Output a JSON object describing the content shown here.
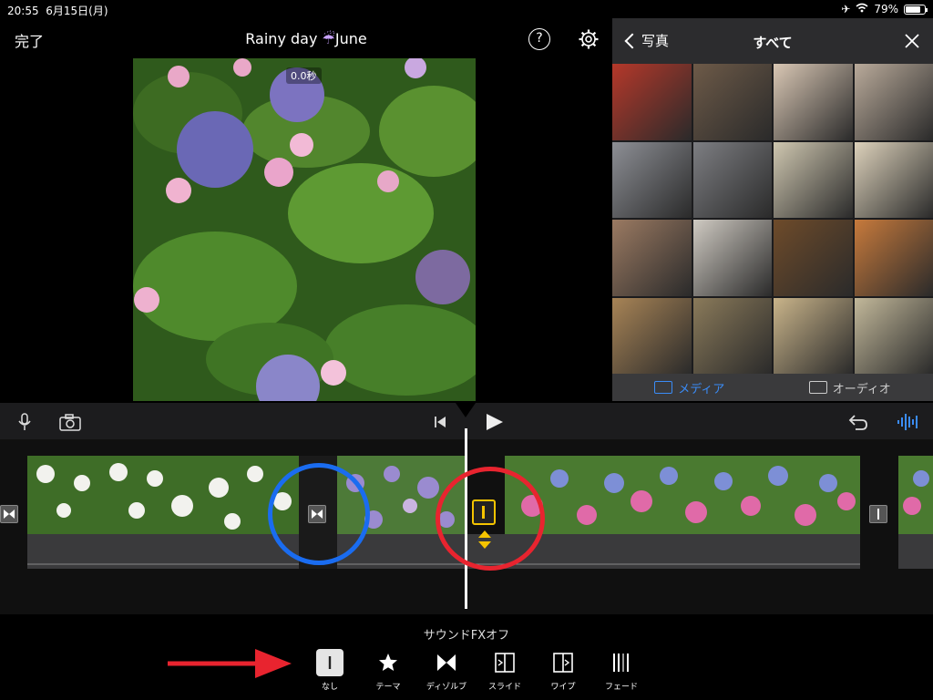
{
  "status": {
    "time": "20:55",
    "date": "6月15日(月)",
    "battery_pct": "79%",
    "battery_level": 0.79
  },
  "topbar": {
    "done": "完了",
    "title_part1": "Rainy day ",
    "title_umbrella": "☔",
    "title_part2": "June",
    "help": "?"
  },
  "preview": {
    "time_badge": "0.0秒"
  },
  "browser": {
    "back": "写真",
    "title": "すべて",
    "tabs": [
      {
        "label": "メディア",
        "active": true
      },
      {
        "label": "オーディオ",
        "active": false
      }
    ],
    "thumb_colors": [
      "#b5382a",
      "#6d5a48",
      "#d9c7b4",
      "#b9aa9a",
      "#8d8f95",
      "#7d7e82",
      "#cfc7b0",
      "#ddd2bb",
      "#9b7a62",
      "#cfcac2",
      "#6e4b2a",
      "#c77a3c",
      "#a88456",
      "#8a7a5a",
      "#c9b48a",
      "#c2b89a"
    ]
  },
  "toolbar": {
    "icons": [
      "microphone-icon",
      "camera-icon",
      "skip-back-icon",
      "play-icon",
      "undo-icon",
      "waveform-icon"
    ]
  },
  "bottom": {
    "sound_label": "サウンドFXオフ",
    "transitions": [
      {
        "label": "なし",
        "icon": "none-icon",
        "selected": true
      },
      {
        "label": "テーマ",
        "icon": "star-icon",
        "selected": false
      },
      {
        "label": "ディゾルブ",
        "icon": "dissolve-icon",
        "selected": false
      },
      {
        "label": "スライド",
        "icon": "slide-icon",
        "selected": false
      },
      {
        "label": "ワイプ",
        "icon": "wipe-icon",
        "selected": false
      },
      {
        "label": "フェード",
        "icon": "fade-icon",
        "selected": false
      }
    ]
  },
  "colors": {
    "accent": "#3a8cf7",
    "selection": "#f5c400",
    "annotation_blue": "#1a6cf0",
    "annotation_red": "#e8242f"
  }
}
